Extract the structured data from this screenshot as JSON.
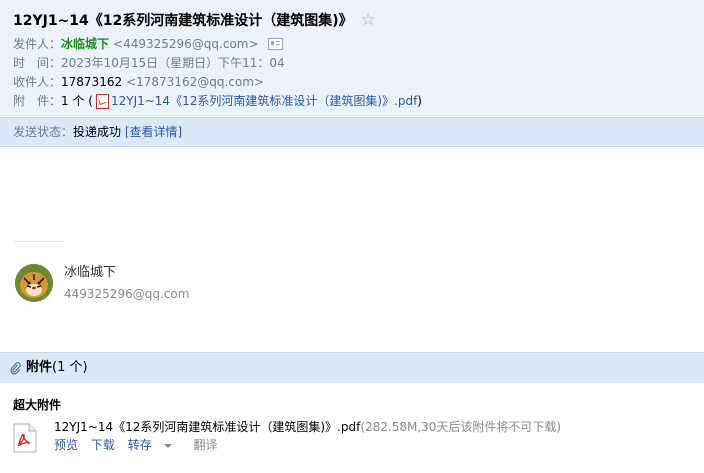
{
  "email": {
    "subject": "12YJ1~14《12系列河南建筑标准设计（建筑图集)》",
    "sender_label": "发件人：",
    "sender_name": "冰临城下",
    "sender_email": "<449325296@qq.com>",
    "time_label": "时　间：",
    "time_value": "2023年10月15日（星期日）下午11：04",
    "recipient_label": "收件人：",
    "recipient_name": "17873162",
    "recipient_email": "<17873162@qq.com>",
    "attachment_label": "附　件：",
    "attachment_count": "1 个 (",
    "attachment_link": "12YJ1~14《12系列河南建筑标准设计（建筑图集)》.pdf",
    "attachment_close": ")"
  },
  "status": {
    "label": "发送状态：",
    "value": "投递成功",
    "link": "[查看详情]"
  },
  "signature": {
    "name": "冰临城下",
    "email": "449325296@qq.com"
  },
  "attachments": {
    "title": "附件",
    "count": "(1 个)",
    "section_label": "超大附件",
    "file_name": "12YJ1~14《12系列河南建筑标准设计（建筑图集)》.pdf",
    "file_info": "(282.58M,30天后该附件将不可下载)",
    "actions": {
      "preview": "预览",
      "download": "下载",
      "forward": "转存",
      "translate": "翻译"
    }
  },
  "colors": {
    "header_bg": "#eaf3fc",
    "bar_bg": "#d9e9f7",
    "link": "#2d58a3",
    "sender_green": "#1f8f1f"
  }
}
